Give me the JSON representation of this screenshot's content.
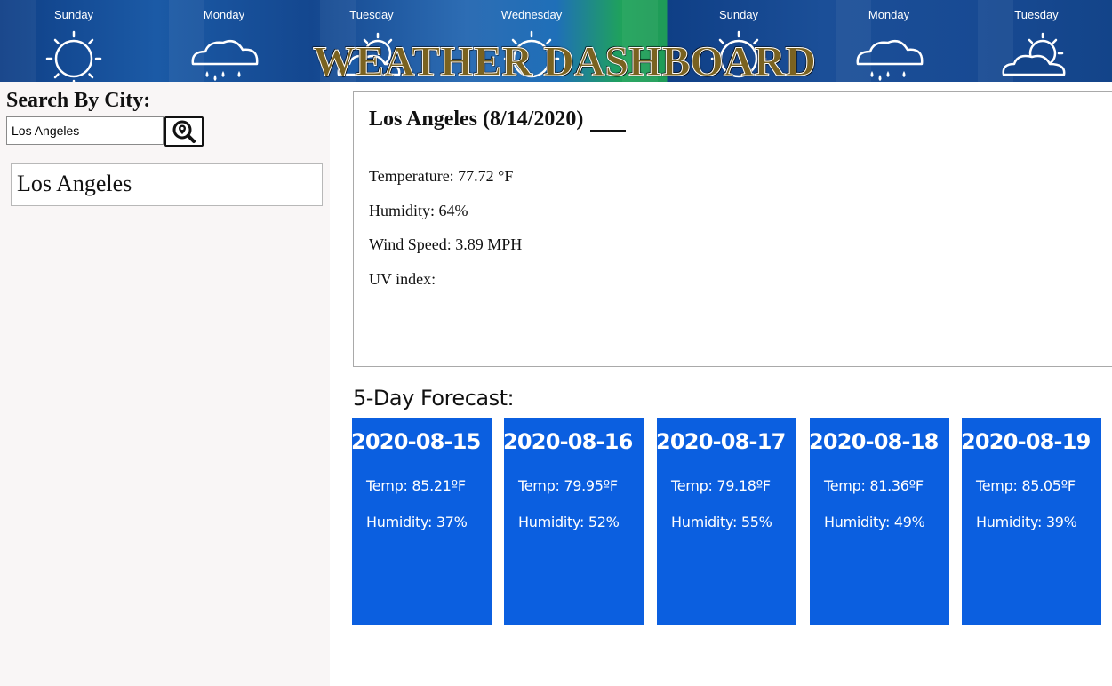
{
  "banner": {
    "title": "WEATHER DASHBOARD",
    "days": [
      {
        "name": "Sunday",
        "icon": "sun-icon"
      },
      {
        "name": "Monday",
        "icon": "rain-cloud-icon"
      },
      {
        "name": "Tuesday",
        "icon": "partly-cloudy-icon"
      },
      {
        "name": "Wednesday",
        "icon": "sun-icon"
      },
      {
        "name": "Sunday",
        "icon": "sun-icon"
      },
      {
        "name": "Monday",
        "icon": "rain-cloud-icon"
      },
      {
        "name": "Tuesday",
        "icon": "partly-cloudy-icon"
      }
    ]
  },
  "sidebar": {
    "heading": "Search By City:",
    "search_value": "Los Angeles",
    "search_button_icon": "search-location-icon",
    "cities": [
      "Los Angeles"
    ]
  },
  "current": {
    "title": "Los Angeles (8/14/2020)",
    "temperature": "Temperature: 77.72 °F",
    "humidity": "Humidity: 64%",
    "wind": "Wind Speed: 3.89 MPH",
    "uv": "UV index:"
  },
  "forecast": {
    "heading": "5-Day Forecast:",
    "days": [
      {
        "date": "2020-08-15",
        "temp": "Temp: 85.21ºF",
        "humidity": "Humidity: 37%"
      },
      {
        "date": "2020-08-16",
        "temp": "Temp: 79.95ºF",
        "humidity": "Humidity: 52%"
      },
      {
        "date": "2020-08-17",
        "temp": "Temp: 79.18ºF",
        "humidity": "Humidity: 55%"
      },
      {
        "date": "2020-08-18",
        "temp": "Temp: 81.36ºF",
        "humidity": "Humidity: 49%"
      },
      {
        "date": "2020-08-19",
        "temp": "Temp: 85.05ºF",
        "humidity": "Humidity: 39%"
      }
    ]
  },
  "colors": {
    "forecast_card": "#0b5fe0",
    "sidebar_bg": "#f9f6f6",
    "title_fill": "#7a6220"
  }
}
